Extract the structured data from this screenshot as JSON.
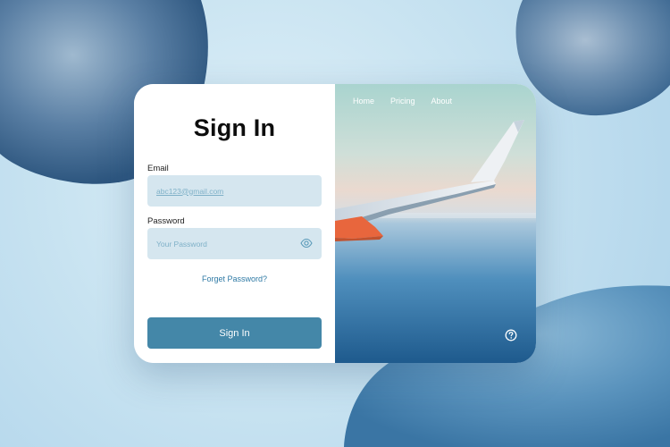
{
  "signin": {
    "title": "Sign In",
    "email_label": "Email",
    "email_placeholder": "abc123@gmail.com",
    "password_label": "Password",
    "password_placeholder": "Your Password",
    "forgot_link": "Forget Password?",
    "button_label": "Sign In"
  },
  "nav": {
    "items": [
      "Home",
      "Pricing",
      "About"
    ]
  },
  "icons": {
    "password_toggle": "eye-icon",
    "help": "question-circle-icon"
  },
  "colors": {
    "accent": "#4487a8",
    "input_bg": "#d5e6ef",
    "link": "#2f7aa5",
    "placeholder": "#7fb1c8"
  }
}
